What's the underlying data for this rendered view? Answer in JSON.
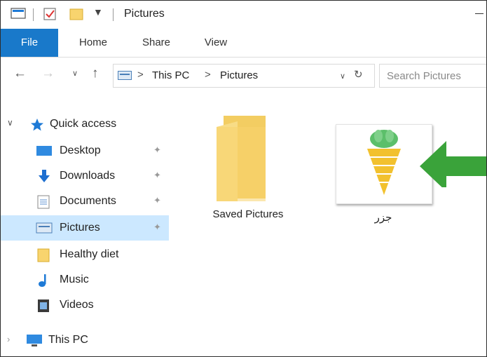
{
  "window": {
    "title": "Pictures"
  },
  "ribbon": {
    "tabs": [
      {
        "label": "File"
      },
      {
        "label": "Home"
      },
      {
        "label": "Share"
      },
      {
        "label": "View"
      }
    ]
  },
  "address": {
    "path": [
      "This PC",
      "Pictures"
    ],
    "separator": ">"
  },
  "search": {
    "placeholder": "Search Pictures"
  },
  "nav_pane": {
    "quick_access": "Quick access",
    "items": [
      {
        "label": "Desktop",
        "icon": "desktop-icon",
        "pinned": true
      },
      {
        "label": "Downloads",
        "icon": "downloads-icon",
        "pinned": true
      },
      {
        "label": "Documents",
        "icon": "documents-icon",
        "pinned": true
      },
      {
        "label": "Pictures",
        "icon": "pictures-icon",
        "pinned": true,
        "selected": true
      },
      {
        "label": "Healthy diet",
        "icon": "folder-icon",
        "pinned": false
      },
      {
        "label": "Music",
        "icon": "music-icon",
        "pinned": false
      },
      {
        "label": "Videos",
        "icon": "videos-icon",
        "pinned": false
      }
    ],
    "this_pc": "This PC"
  },
  "content": {
    "items": [
      {
        "label": "Saved Pictures",
        "type": "folder"
      },
      {
        "label": "جزر",
        "type": "image"
      }
    ]
  },
  "colors": {
    "file_tab": "#1979ca",
    "selected_bg": "#cce8ff",
    "folder": "#f8d46e",
    "arrow": "#3aa33a",
    "star": "#1e7ad6"
  }
}
